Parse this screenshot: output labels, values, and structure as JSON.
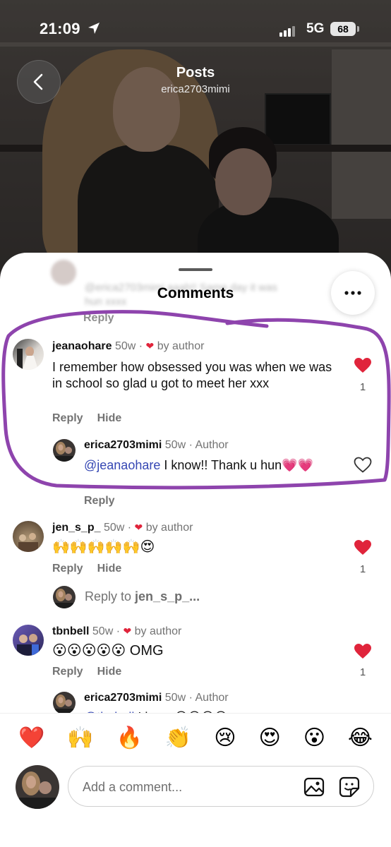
{
  "status_bar": {
    "time": "21:09",
    "network": "5G",
    "battery": "68"
  },
  "header": {
    "title": "Posts",
    "subtitle": "erica2703mimi"
  },
  "sheet": {
    "title": "Comments",
    "previous": {
      "line1": "@erica2703mimi  aaah!! Same day it was",
      "line2": "hun xxxx",
      "reply_label": "Reply"
    }
  },
  "comments": [
    {
      "username": "jeanaohare",
      "time": "50w",
      "liked_by": "by author",
      "text": "I remember how obsessed you was when we was in school so glad u got to meet her xxx",
      "reply_label": "Reply",
      "hide_label": "Hide",
      "likes": "1",
      "liked": true,
      "replies": [
        {
          "username": "erica2703mimi",
          "time": "50w",
          "badge": "Author",
          "mention": "@jeanaohare",
          "text": " I know!! Thank u hun💗💗",
          "reply_label": "Reply",
          "liked": false
        }
      ]
    },
    {
      "username": "jen_s_p_",
      "time": "50w",
      "liked_by": "by author",
      "text": "🙌🙌🙌🙌🙌😍",
      "reply_label": "Reply",
      "hide_label": "Hide",
      "likes": "1",
      "liked": true,
      "reply_prompt": {
        "prefix": "Reply to ",
        "username": "jen_s_p_..."
      }
    },
    {
      "username": "tbnbell",
      "time": "50w",
      "liked_by": "by author",
      "text": "😮😮😮😮😮 OMG",
      "reply_label": "Reply",
      "hide_label": "Hide",
      "likes": "1",
      "liked": true,
      "replies": [
        {
          "username": "erica2703mimi",
          "time": "50w",
          "badge": "Author",
          "mention": "@tbnbell",
          "text": " I know😊😊😊😊"
        }
      ]
    }
  ],
  "emoji_bar": [
    "❤️",
    "🙌",
    "🔥",
    "👏",
    "😢",
    "😍",
    "😮",
    "😂"
  ],
  "composer": {
    "placeholder": "Add a comment..."
  },
  "colors": {
    "like_red": "#e0243b",
    "mention_blue": "#3547b3",
    "highlight_purple": "#8e44ad"
  }
}
